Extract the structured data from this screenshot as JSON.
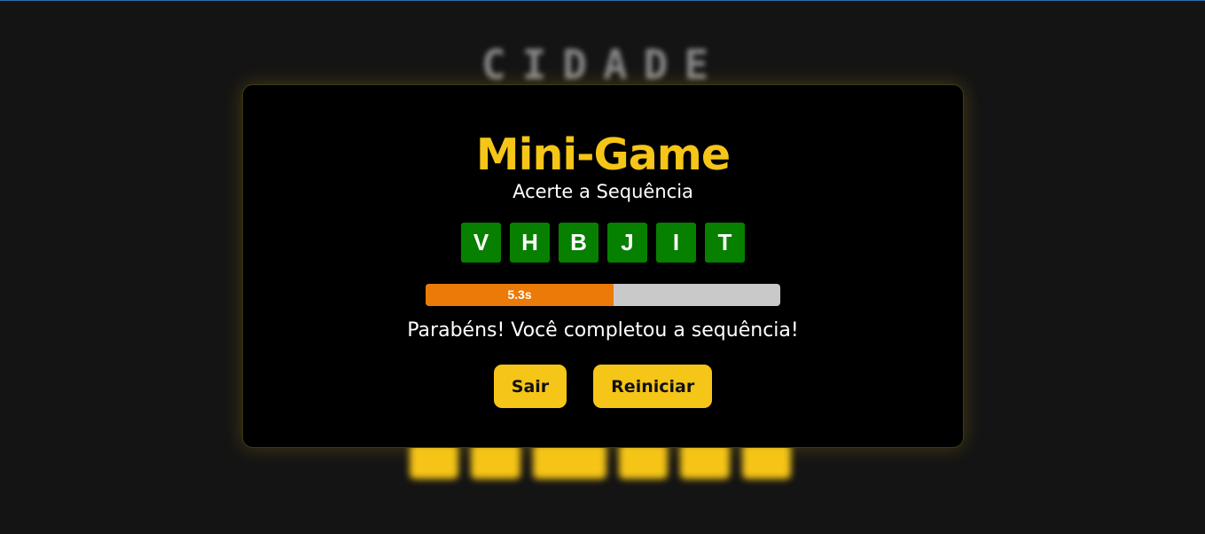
{
  "background": {
    "title_text": "CIDADE",
    "button_count": 6
  },
  "modal": {
    "title": "Mini-Game",
    "subtitle": "Acerte a Sequência",
    "sequence": [
      "V",
      "H",
      "B",
      "J",
      "I",
      "T"
    ],
    "timer": {
      "label": "5.3s",
      "remaining_fraction": 0.53
    },
    "message": "Parabéns! Você completou a sequência!",
    "buttons": {
      "exit_label": "Sair",
      "restart_label": "Reiniciar"
    }
  },
  "colors": {
    "accent": "#f5c518",
    "key_correct": "#078000",
    "timer_fill": "#ec7a08",
    "timer_track": "#c9c9c9"
  }
}
